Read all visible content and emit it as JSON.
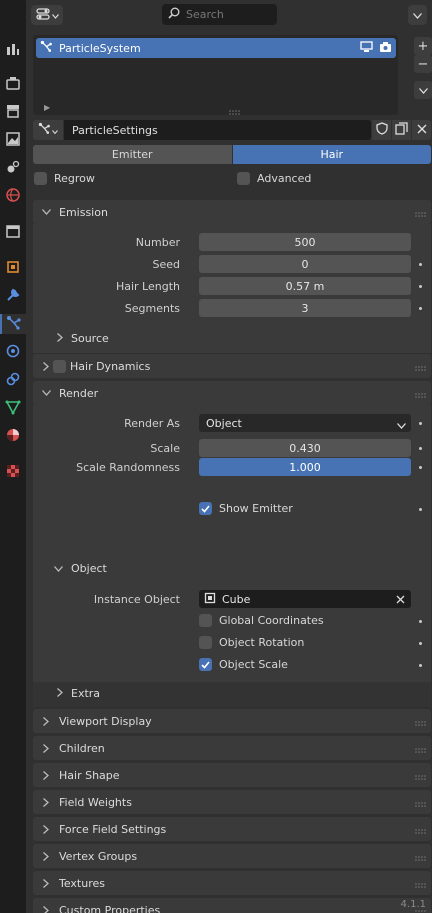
{
  "header": {
    "search_placeholder": "Search"
  },
  "tabs": [
    {
      "icon": "tool-icon",
      "active": false
    },
    {
      "icon": "render-icon",
      "active": false
    },
    {
      "icon": "output-icon",
      "active": false
    },
    {
      "icon": "view-layer-icon",
      "active": false
    },
    {
      "icon": "scene-icon",
      "active": false
    },
    {
      "icon": "world-icon",
      "active": false
    },
    {
      "icon": "collection-icon",
      "active": false
    },
    {
      "icon": "object-icon",
      "active": false
    },
    {
      "icon": "modifier-icon",
      "active": false
    },
    {
      "icon": "particles-icon",
      "active": true
    },
    {
      "icon": "physics-icon",
      "active": false
    },
    {
      "icon": "constraints-icon",
      "active": false
    },
    {
      "icon": "data-icon",
      "active": false
    },
    {
      "icon": "material-icon",
      "active": false
    },
    {
      "icon": "texture-icon",
      "active": false
    }
  ],
  "particle_list": {
    "item_name": "ParticleSystem"
  },
  "settings": {
    "name": "ParticleSettings",
    "tab_emitter": "Emitter",
    "tab_hair": "Hair",
    "active_tab": "Hair",
    "regrow_label": "Regrow",
    "regrow_checked": false,
    "advanced_label": "Advanced",
    "advanced_checked": false
  },
  "emission": {
    "title": "Emission",
    "number_label": "Number",
    "number_value": "500",
    "seed_label": "Seed",
    "seed_value": "0",
    "hair_length_label": "Hair Length",
    "hair_length_value": "0.57 m",
    "segments_label": "Segments",
    "segments_value": "3",
    "source_label": "Source"
  },
  "hair_dynamics": {
    "title": "Hair Dynamics",
    "enabled": false
  },
  "render": {
    "title": "Render",
    "render_as_label": "Render As",
    "render_as_value": "Object",
    "scale_label": "Scale",
    "scale_value": "0.430",
    "scale_random_label": "Scale Randomness",
    "scale_random_value": "1.000",
    "scale_random_fraction": 1.0,
    "show_emitter_label": "Show Emitter",
    "show_emitter_checked": true,
    "object_subpanel": "Object",
    "instance_object_label": "Instance Object",
    "instance_object_value": "Cube",
    "global_coords_label": "Global Coordinates",
    "global_coords_checked": false,
    "object_rotation_label": "Object Rotation",
    "object_rotation_checked": false,
    "object_scale_label": "Object Scale",
    "object_scale_checked": true,
    "extra_label": "Extra"
  },
  "collapsed_panels": [
    "Viewport Display",
    "Children",
    "Hair Shape",
    "Field Weights",
    "Force Field Settings",
    "Vertex Groups",
    "Textures",
    "Custom Properties"
  ],
  "version": "4.1.1",
  "colors": {
    "accent": "#4772b3",
    "panel": "#3a3a3a",
    "background": "#303030"
  }
}
